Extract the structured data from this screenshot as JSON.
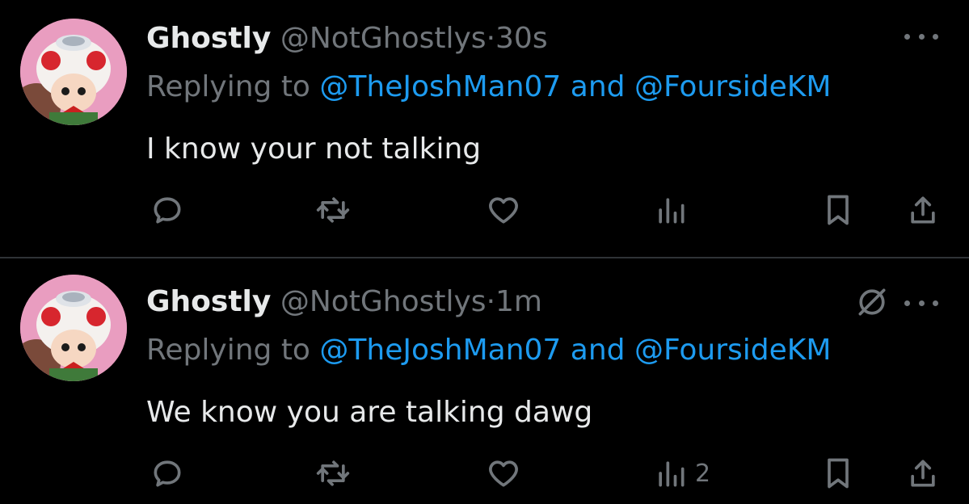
{
  "tweets": [
    {
      "name": "Ghostly",
      "handle": "@NotGhostlys",
      "separator": "·",
      "time": "30s",
      "replying_prefix": "Replying to",
      "mention_1": "@TheJoshMan07",
      "mention_join": "and",
      "mention_2": "@FoursideKM",
      "text": "I know your not talking",
      "views_count": ""
    },
    {
      "name": "Ghostly",
      "handle": "@NotGhostlys",
      "separator": "·",
      "time": "1m",
      "replying_prefix": "Replying to",
      "mention_1": "@TheJoshMan07",
      "mention_join": "and",
      "mention_2": "@FoursideKM",
      "text": "We know you are talking dawg",
      "views_count": "2"
    }
  ],
  "colors": {
    "background": "#000000",
    "text": "#e7e9ea",
    "muted": "#71767b",
    "link": "#1d9bf0",
    "divider": "#2f3336"
  },
  "icons": [
    "avatar-image",
    "reply-icon",
    "retweet-icon",
    "like-icon",
    "views-icon",
    "bookmark-icon",
    "share-icon",
    "more-icon",
    "hidden-reply-icon"
  ]
}
